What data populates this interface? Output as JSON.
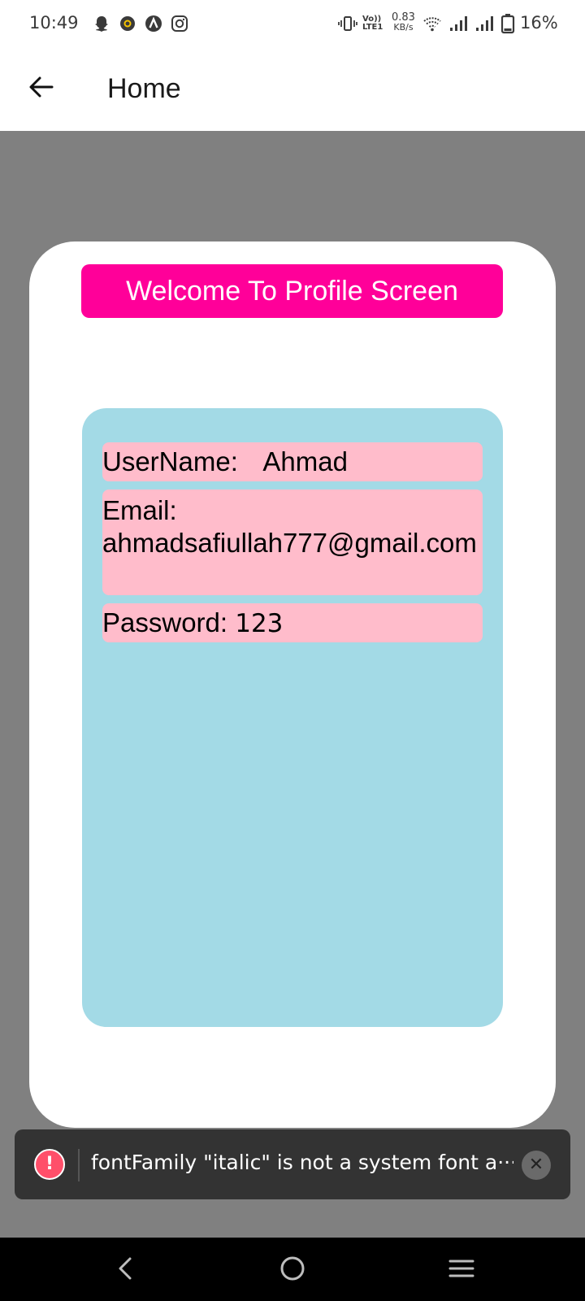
{
  "status_bar": {
    "time": "10:49",
    "net_speed_value": "0.83",
    "net_speed_unit": "KB/s",
    "volte_top": "Vo))",
    "volte_bottom": "LTE1",
    "battery": "16%",
    "icons": [
      "snapchat-icon",
      "chat-icon",
      "arc-icon",
      "instagram-icon",
      "vibrate-icon",
      "volte-icon",
      "wifi-icon",
      "signal-icon",
      "signal-icon",
      "battery-icon"
    ]
  },
  "header": {
    "title": "Home"
  },
  "profile": {
    "welcome_text": "Welcome To Profile Screen",
    "username_label": "UserName:",
    "username_value": "Ahmad",
    "email_label": "Email:",
    "email_value": "ahmadsafiullah777@gmail.com",
    "password_label": "Password:",
    "password_value": "123"
  },
  "toast": {
    "message": "fontFamily \"italic\" is not a system font a···"
  },
  "colors": {
    "accent": "#ff0099",
    "panel": "#a3dae6",
    "field": "#ffbccb",
    "backdrop": "#808080",
    "toast": "#333333",
    "error": "#ff4f6a"
  }
}
